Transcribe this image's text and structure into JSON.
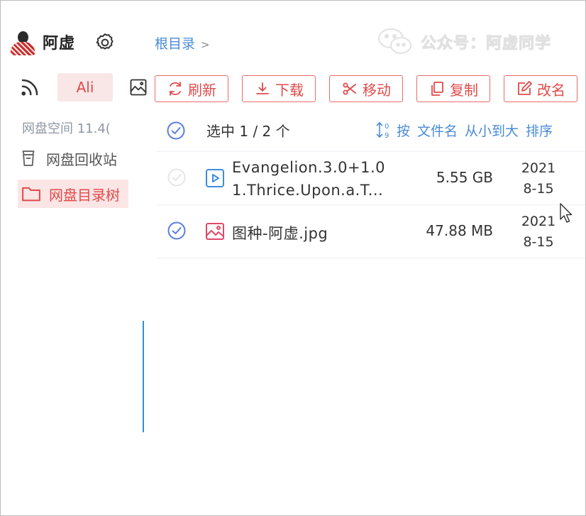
{
  "user": {
    "name": "阿虚"
  },
  "sidebar": {
    "tabs": {
      "ali_label": "Ali"
    },
    "space_label": "网盘空间 11.4(",
    "items": [
      {
        "label": "网盘回收站",
        "icon": "trash-icon"
      },
      {
        "label": "网盘目录树",
        "icon": "folder-icon",
        "active": true
      }
    ]
  },
  "breadcrumb": {
    "root": "根目录",
    "separator": ">"
  },
  "watermark": {
    "text": "公众号：阿虚同学"
  },
  "toolbar": {
    "refresh": "刷新",
    "download": "下载",
    "move": "移动",
    "copy": "复制",
    "rename": "改名"
  },
  "selection": {
    "text": "选中 1 / 2 个",
    "sort": {
      "prefix": "按",
      "field": "文件名",
      "order": "从小到大",
      "suffix": "排序"
    }
  },
  "files": [
    {
      "name_line1": "Evangelion.3.0+1.0",
      "name_line2": "1.Thrice.Upon.a.T...",
      "size": "5.55 GB",
      "date_line1": "2021",
      "date_line2": "8-15",
      "type": "video",
      "selected": false
    },
    {
      "name_line1": "图种-阿虚.jpg",
      "size": "47.88 MB",
      "date_line1": "2021",
      "date_line2": "8-15",
      "type": "image",
      "selected": true
    }
  ],
  "colors": {
    "accent_red": "#e04a4a",
    "accent_red_bg": "#f9e7e7",
    "link_blue": "#4a8bd6",
    "check_blue": "#5b7fe0",
    "muted_text": "#8f97a3"
  }
}
